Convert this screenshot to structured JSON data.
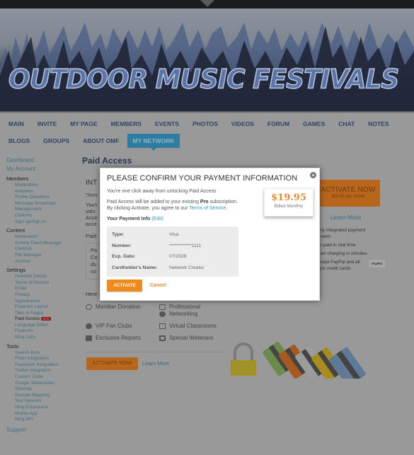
{
  "banner": {
    "title": "OUTDOOR MUSIC FESTIVALS"
  },
  "nav": {
    "row1": [
      "MAIN",
      "INVITE",
      "MY PAGE",
      "MEMBERS",
      "EVENTS",
      "PHOTOS",
      "VIDEOS",
      "FORUM",
      "GAMES",
      "CHAT",
      "NOTES"
    ],
    "row2": [
      "BLOGS",
      "GROUPS",
      "ABOUT OMF",
      "MY NETWORK"
    ],
    "active": "MY NETWORK"
  },
  "sidebar": {
    "dashboard": "Dashboard",
    "my_account": "My Account",
    "sections": [
      {
        "heading": "Members",
        "items": [
          "Moderation",
          "Invitation",
          "Profile Questions",
          "Message Broadcast",
          "Management",
          "Controls",
          "Sign up/Sign in"
        ]
      },
      {
        "heading": "Content",
        "items": [
          "Moderation",
          "Activity Feed Message",
          "Controls",
          "File Manager",
          "Archive"
        ]
      },
      {
        "heading": "Settings",
        "items": [
          "Network Details",
          "Terms of Service",
          "Email",
          "Privacy",
          "Appearance",
          "Features Layout",
          "Tabs & Pages",
          "Paid Access",
          "Language Editor",
          "Features",
          "Ning Labs"
        ]
      },
      {
        "heading": "Tools",
        "items": [
          "Search Bots",
          "Flickr Integration",
          "Facebook Integration",
          "Twitter Integration",
          "Custom Code",
          "Google Webmaster",
          "Sitemap",
          "Domain Mapping",
          "Test Network",
          "Ning Extensions",
          "Mobile App",
          "Ning API"
        ]
      }
    ],
    "current_item": "Paid Access",
    "current_badge": "NEW",
    "support": "Support"
  },
  "main": {
    "title": "Paid Access",
    "fragments": [
      "INT",
      "TRAN",
      "You'r",
      "valu",
      "Acce",
      "acce",
      "Paid",
      "Pa",
      "Co",
      "du",
      "co",
      "Here"
    ],
    "features": [
      {
        "icon": "donation-icon",
        "label": "Member Donation"
      },
      {
        "icon": "chat-icon",
        "label": "Professional"
      },
      {
        "icon": "network-icon",
        "label": "Networking"
      },
      {
        "icon": "badge-icon",
        "label": "VIP Fan Clubs"
      },
      {
        "icon": "book-icon",
        "label": "Virtual Classrooms"
      },
      {
        "icon": "folder-icon",
        "label": "Exclusive Reports"
      },
      {
        "icon": "webinar-icon",
        "label": "Special Webinars"
      }
    ],
    "activate_now": "ACTIVATE NOW",
    "learn_more": "Learn More"
  },
  "promo": {
    "button_title": "ACTIVATE NOW",
    "button_sub": "$19.95 per month",
    "learn_more": "Learn More",
    "benefits": [
      "lly integrated payment",
      "stem",
      "t paid in real time",
      "art charging in minutes",
      "cept PayPal and all",
      "jor credit cards"
    ],
    "paypal": "PayPal"
  },
  "modal": {
    "title": "PLEASE CONFIRM YOUR PAYMENT INFORMATION",
    "intro": "You're one click away from unlocking Paid Access",
    "line1_pre": "Paid Access will be added to your existing ",
    "line1_bold": "Pro",
    "line1_post": " subscription.",
    "line2_pre": "By clicking Activate, you agree to our ",
    "line2_link": "Terms of Service",
    "line2_post": ".",
    "payment_heading": "Your Payment Info",
    "edit_link": "(Edit)",
    "price": "$19.95",
    "billing": "Billed Monthly",
    "payment": [
      {
        "key": "Type:",
        "value": "Visa"
      },
      {
        "key": "Number:",
        "value": "************1111"
      },
      {
        "key": "Exp. Date:",
        "value": "07/2029"
      },
      {
        "key": "Cardholder's Name:",
        "value": "Network Creator"
      }
    ],
    "activate": "ACTIVATE",
    "cancel": "Cancel"
  }
}
